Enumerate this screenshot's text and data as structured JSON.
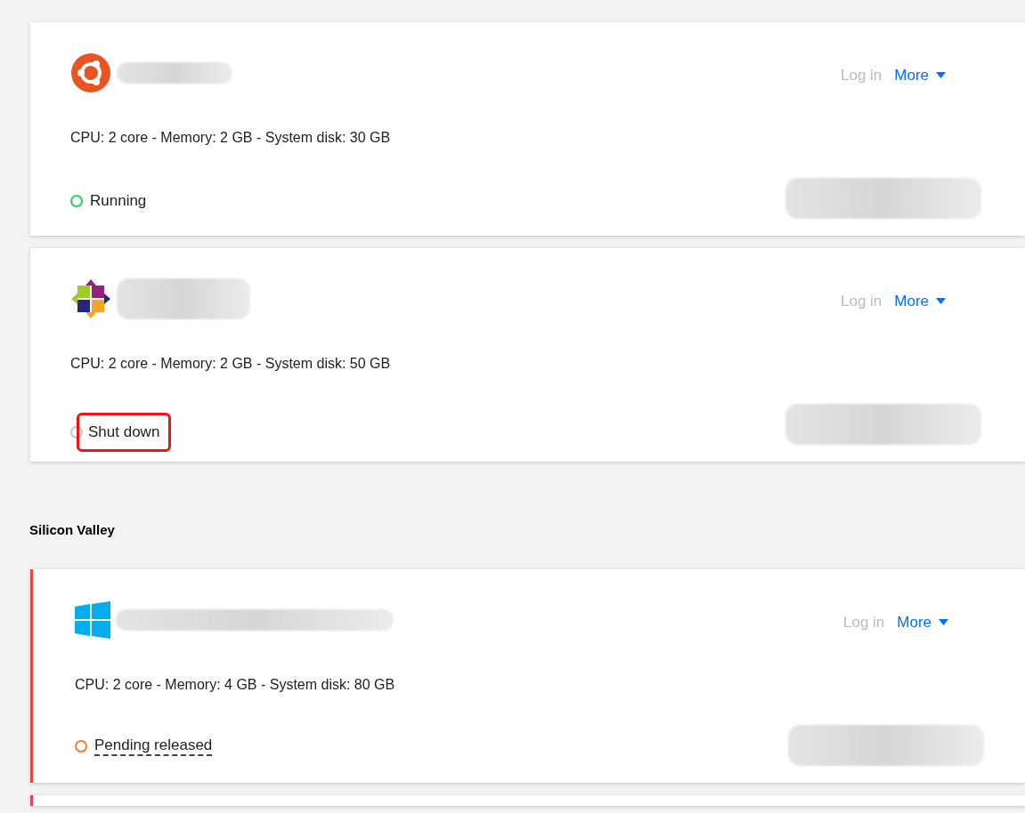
{
  "groups": [
    {
      "instances": [
        {
          "kind": "ubuntu",
          "specs": "CPU: 2 core - Memory: 2 GB - System disk: 30 GB",
          "status": {
            "kind": "running",
            "label": "Running",
            "highlighted": false
          },
          "alert": false,
          "actions": {
            "login": "Log in",
            "more": "More"
          }
        },
        {
          "kind": "centos",
          "specs": "CPU: 2 core - Memory: 2 GB - System disk: 50 GB",
          "status": {
            "kind": "stopped",
            "label": "Shut down",
            "highlighted": true
          },
          "alert": false,
          "actions": {
            "login": "Log in",
            "more": "More"
          }
        }
      ]
    },
    {
      "region": "Silicon Valley",
      "instances": [
        {
          "kind": "windows",
          "specs": "CPU: 2 core - Memory: 4 GB - System disk: 80 GB",
          "status": {
            "kind": "pending",
            "label": "Pending released",
            "highlighted": false
          },
          "alert": true,
          "actions": {
            "login": "Log in",
            "more": "More"
          }
        },
        {
          "kind": "partial",
          "alert": true
        }
      ]
    }
  ]
}
